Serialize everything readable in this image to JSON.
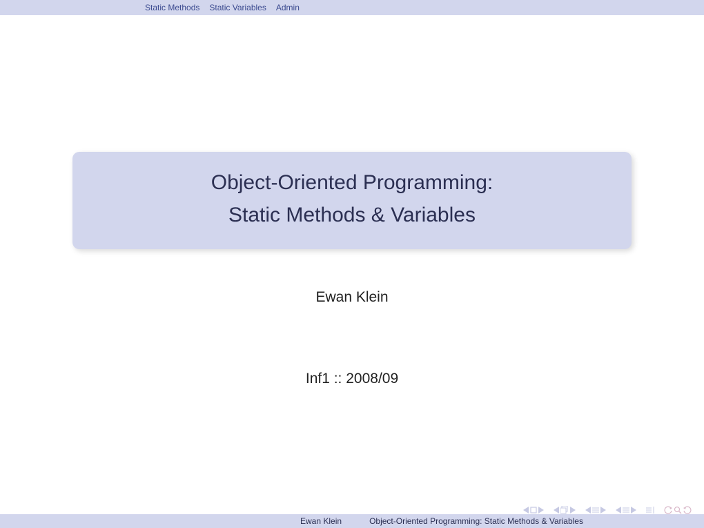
{
  "nav": {
    "items": [
      "Static Methods",
      "Static Variables",
      "Admin"
    ]
  },
  "title": {
    "line1": "Object-Oriented Programming:",
    "line2": "Static Methods & Variables"
  },
  "author": "Ewan Klein",
  "course": "Inf1 :: 2008/09",
  "footer": {
    "author": "Ewan Klein",
    "title": "Object-Oriented Programming: Static Methods & Variables"
  },
  "colors": {
    "bar": "#d2d6ed",
    "link": "#3b4a8f",
    "navicon": "#c6c9e3",
    "navicon2": "#d9b8c9"
  }
}
